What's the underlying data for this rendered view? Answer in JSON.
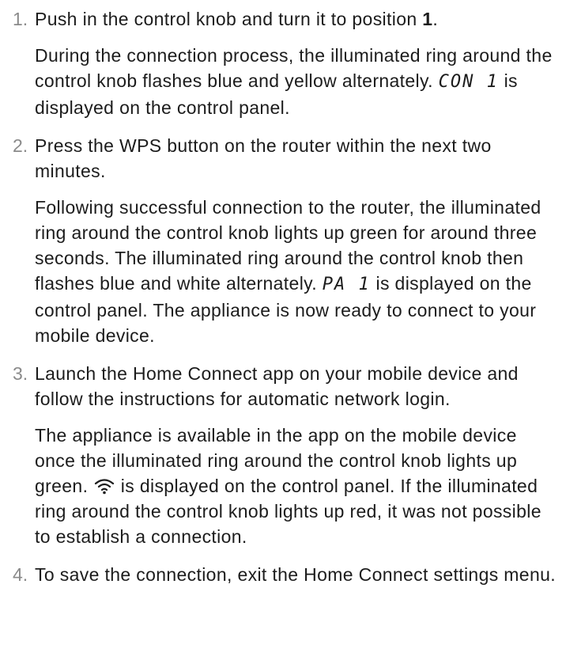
{
  "steps": [
    {
      "number": "1.",
      "instruction": "Push in the control knob and turn it to position ",
      "position_value": "1",
      "instruction_end": ".",
      "detail_before": "During the connection process, the illuminated ring around the control knob flashes blue and yellow alternately. ",
      "display_code": "CON 1",
      "detail_after": " is displayed on the control panel."
    },
    {
      "number": "2.",
      "instruction": "Press the WPS button on the router within the next two minutes.",
      "detail_before": "Following successful connection to the router, the illuminated ring around the control knob lights up green for around three seconds. The illuminated ring around the control knob then flashes blue and white alternately. ",
      "display_code": "PA 1",
      "detail_after": " is displayed on the control panel. The appliance is now ready to connect to your mobile device."
    },
    {
      "number": "3.",
      "instruction": "Launch the Home Connect app on your mobile device and follow the instructions for automatic network login.",
      "detail_before": "The appliance is available in the app on the mobile device once the illuminated ring around the control knob lights up green. ",
      "display_icon": "wifi-icon",
      "detail_after": " is displayed on the control panel. If the illuminated ring around the control knob lights up red, it was not possible to establish a connection."
    },
    {
      "number": "4.",
      "instruction": "To save the connection, exit the Home Connect settings menu."
    }
  ]
}
